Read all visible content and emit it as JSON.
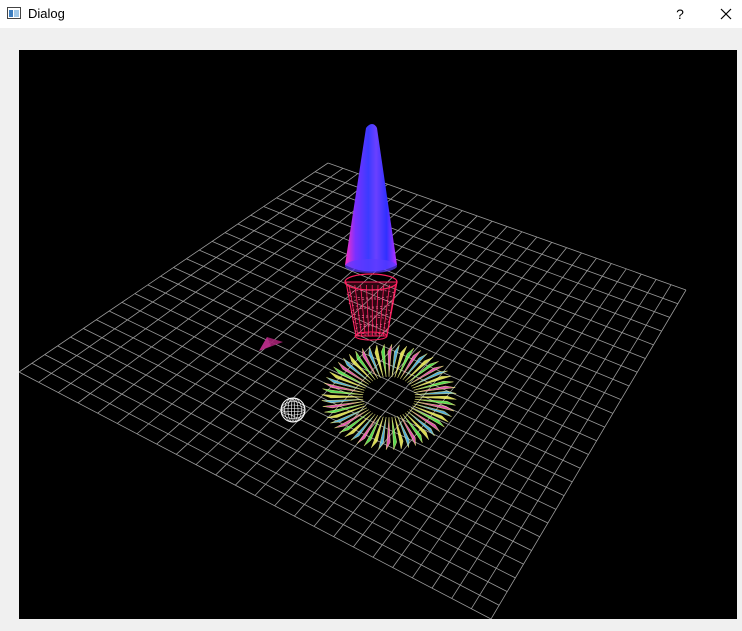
{
  "window": {
    "title": "Dialog",
    "help_label": "?",
    "icons": {
      "app": "window-icon",
      "help": "help-icon",
      "close": "close-icon"
    }
  },
  "scene": {
    "background": "#000000",
    "grid_color": "#9a9a9a",
    "objects": [
      {
        "name": "cone",
        "colors": [
          "#3b3bff",
          "#a030ff",
          "#ff30a0"
        ]
      },
      {
        "name": "wire-cylinder",
        "color": "#ff2060"
      },
      {
        "name": "torus",
        "colors": [
          "#ffff66",
          "#66ff66",
          "#ff66cc",
          "#66ccff"
        ]
      },
      {
        "name": "wire-sphere",
        "color": "#ffffff"
      },
      {
        "name": "triangle",
        "color": "#a02070"
      }
    ]
  }
}
